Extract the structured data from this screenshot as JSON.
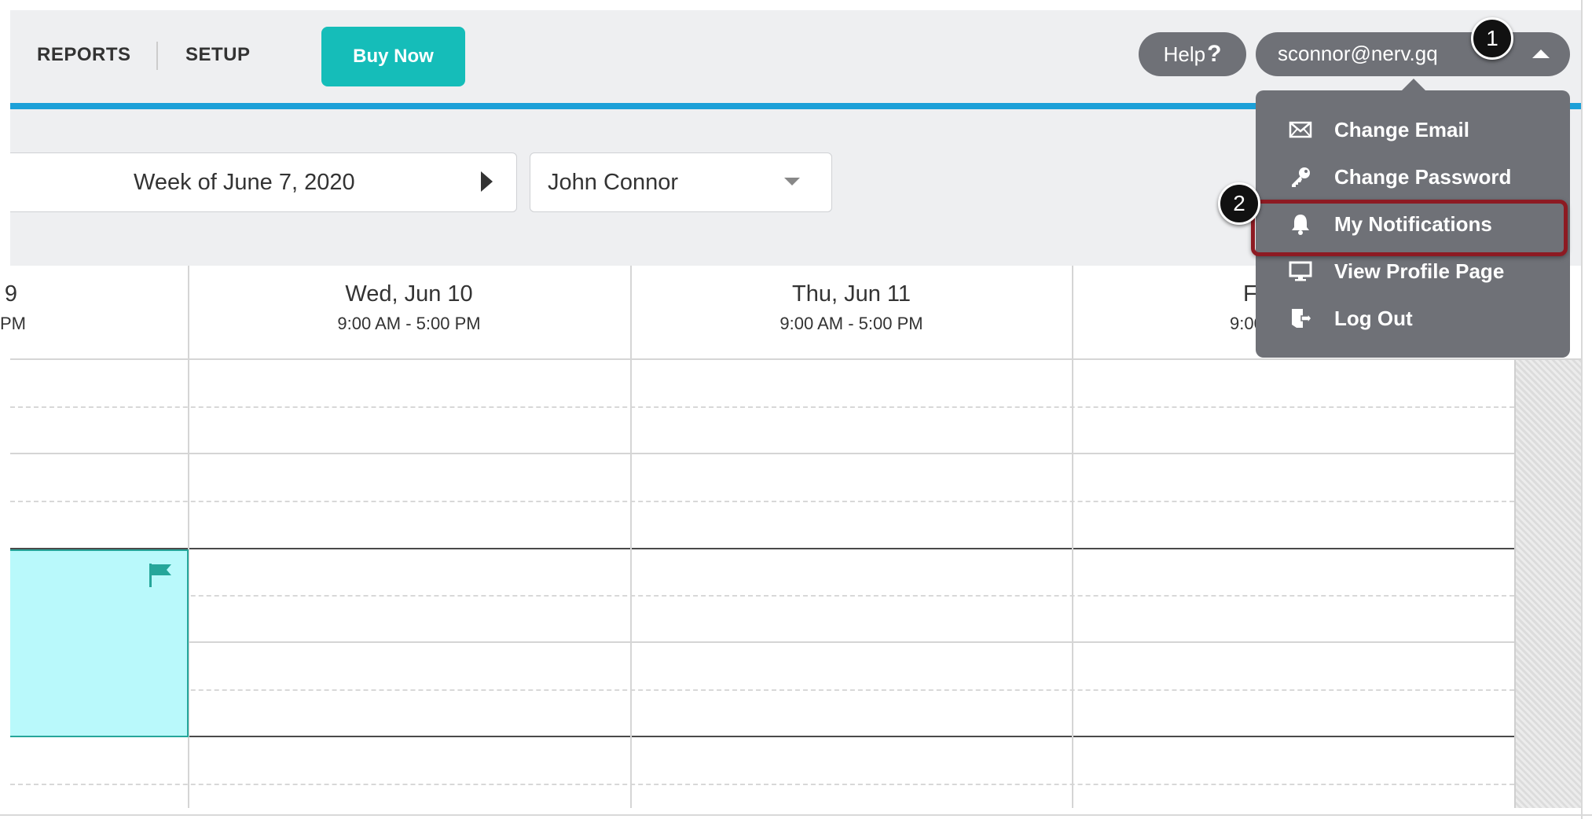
{
  "header": {
    "nav": [
      "REPORTS",
      "SETUP"
    ],
    "buy_label": "Buy Now",
    "help_label": "Help",
    "help_mark": "?",
    "user_email": "sconnor@nerv.gq"
  },
  "toolbar": {
    "week_label": "Week of June 7, 2020",
    "person": "John Connor"
  },
  "calendar": {
    "columns": [
      {
        "day": "9",
        "hours": "PM"
      },
      {
        "day": "Wed, Jun 10",
        "hours": "9:00 AM - 5:00 PM"
      },
      {
        "day": "Thu, Jun 11",
        "hours": "9:00 AM - 5:00 PM"
      },
      {
        "day": "F",
        "hours": "9:00"
      }
    ]
  },
  "user_menu": {
    "items": [
      {
        "label": "Change Email",
        "icon": "envelope-icon"
      },
      {
        "label": "Change Password",
        "icon": "key-icon"
      },
      {
        "label": "My Notifications",
        "icon": "bell-icon"
      },
      {
        "label": "View Profile Page",
        "icon": "monitor-icon"
      },
      {
        "label": "Log Out",
        "icon": "logout-icon"
      }
    ]
  },
  "annotations": {
    "step1": "1",
    "step2": "2"
  },
  "colors": {
    "accent": "#15bdb9",
    "header_line": "#1ba0d8",
    "highlight_border": "#8d1a22",
    "event_fill": "#b9f9fb"
  }
}
